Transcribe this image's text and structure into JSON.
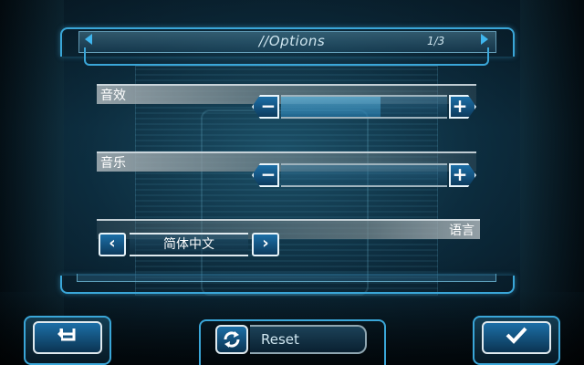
{
  "header": {
    "title": "//Options",
    "page": "1/3",
    "prev_icon": "triangle-left",
    "next_icon": "triangle-right"
  },
  "options": {
    "sound_effects": {
      "label": "音效",
      "level": 0.6,
      "minus": "−",
      "plus": "+"
    },
    "music": {
      "label": "音乐",
      "level": 0.0,
      "minus": "−",
      "plus": "+"
    },
    "language": {
      "label": "语言",
      "value": "简体中文",
      "prev": "‹",
      "next": "›"
    }
  },
  "footer": {
    "back_icon": "return-arrow",
    "reset_icon": "refresh-arrows",
    "reset_label": "Reset",
    "confirm_icon": "checkmark"
  },
  "colors": {
    "accent": "#3aa6d8",
    "button": "#1c6fa7",
    "text": "#dfe9ee"
  }
}
